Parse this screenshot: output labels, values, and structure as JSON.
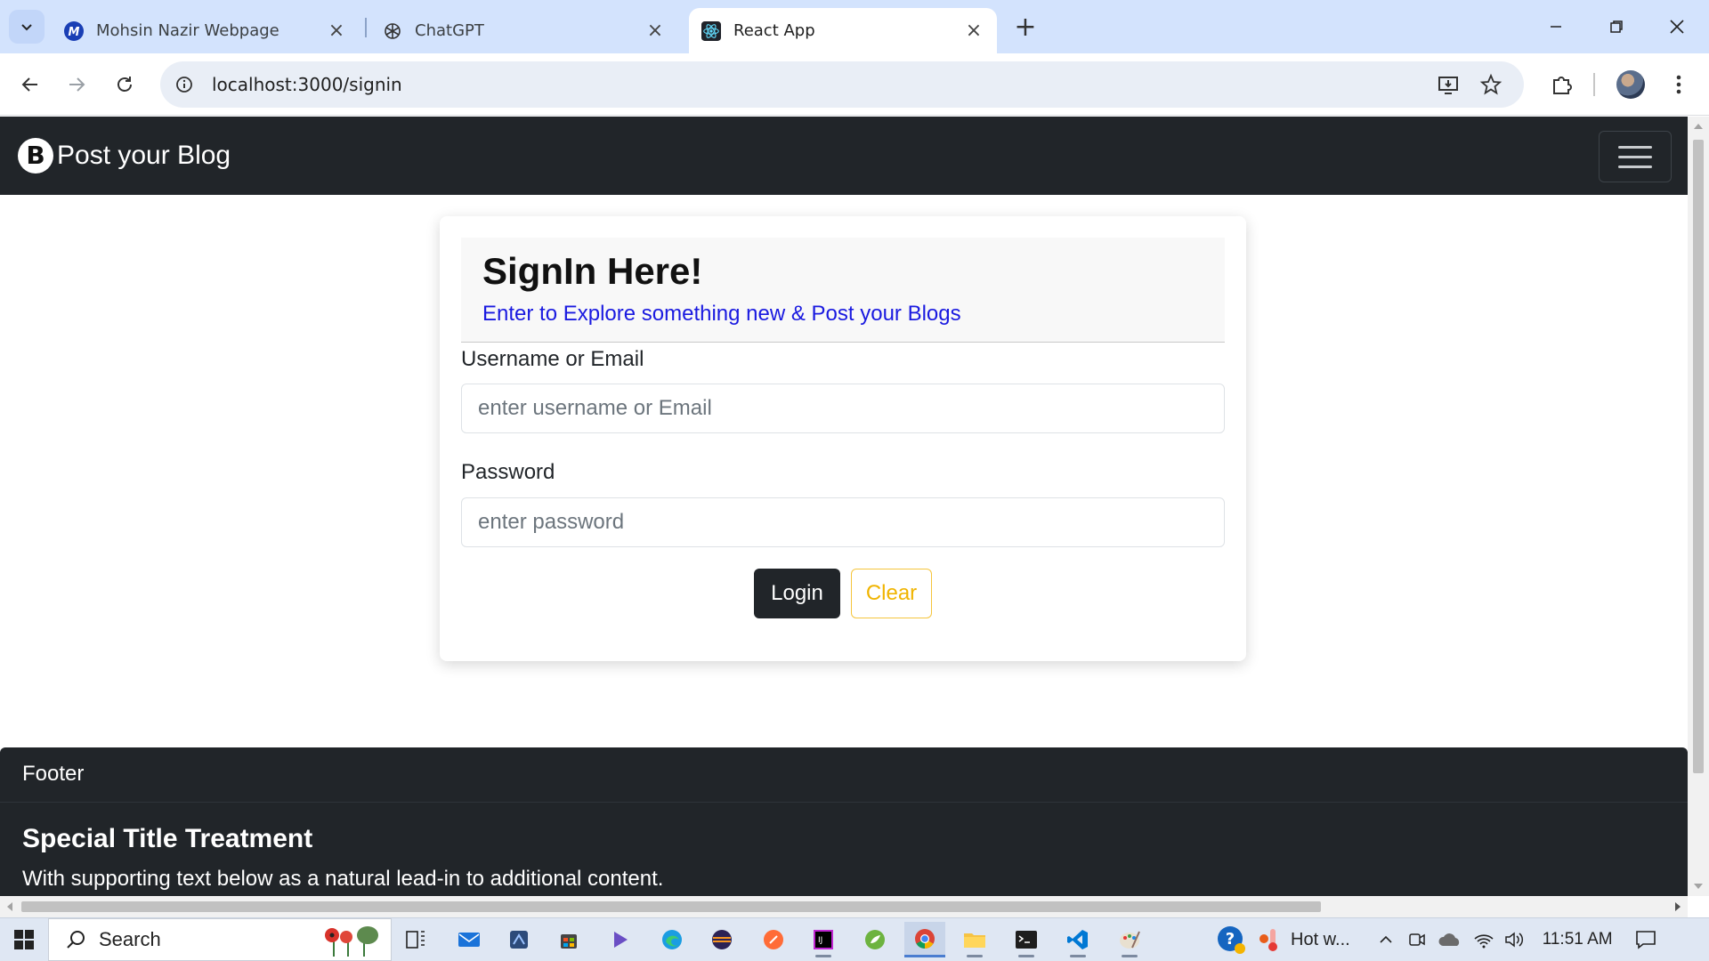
{
  "browser": {
    "tabs": [
      {
        "title": "Mohsin Nazir Webpage",
        "icon": "m-logo-icon",
        "active": false
      },
      {
        "title": "ChatGPT",
        "icon": "openai-icon",
        "active": false
      },
      {
        "title": "React App",
        "icon": "react-icon",
        "active": true
      }
    ],
    "url": "localhost:3000/signin"
  },
  "navbar": {
    "brand_letter": "B",
    "brand_text": "Post your Blog"
  },
  "signin": {
    "title": "SignIn Here!",
    "subtitle": "Enter to Explore something new & Post your Blogs",
    "username_label": "Username or Email",
    "username_placeholder": "enter username or Email",
    "password_label": "Password",
    "password_placeholder": "enter password",
    "login_label": "Login",
    "clear_label": "Clear"
  },
  "footer": {
    "header": "Footer",
    "title": "Special Title Treatment",
    "text": "With supporting text below as a natural lead-in to additional content."
  },
  "taskbar": {
    "search_label": "Search",
    "weather": "Hot w...",
    "time": "11:51 AM"
  },
  "colors": {
    "navbar_bg": "#212529",
    "subtitle": "#1a1ae0",
    "clear_button": "#f0b400",
    "chrome_tabstrip": "#d3e3fd"
  }
}
